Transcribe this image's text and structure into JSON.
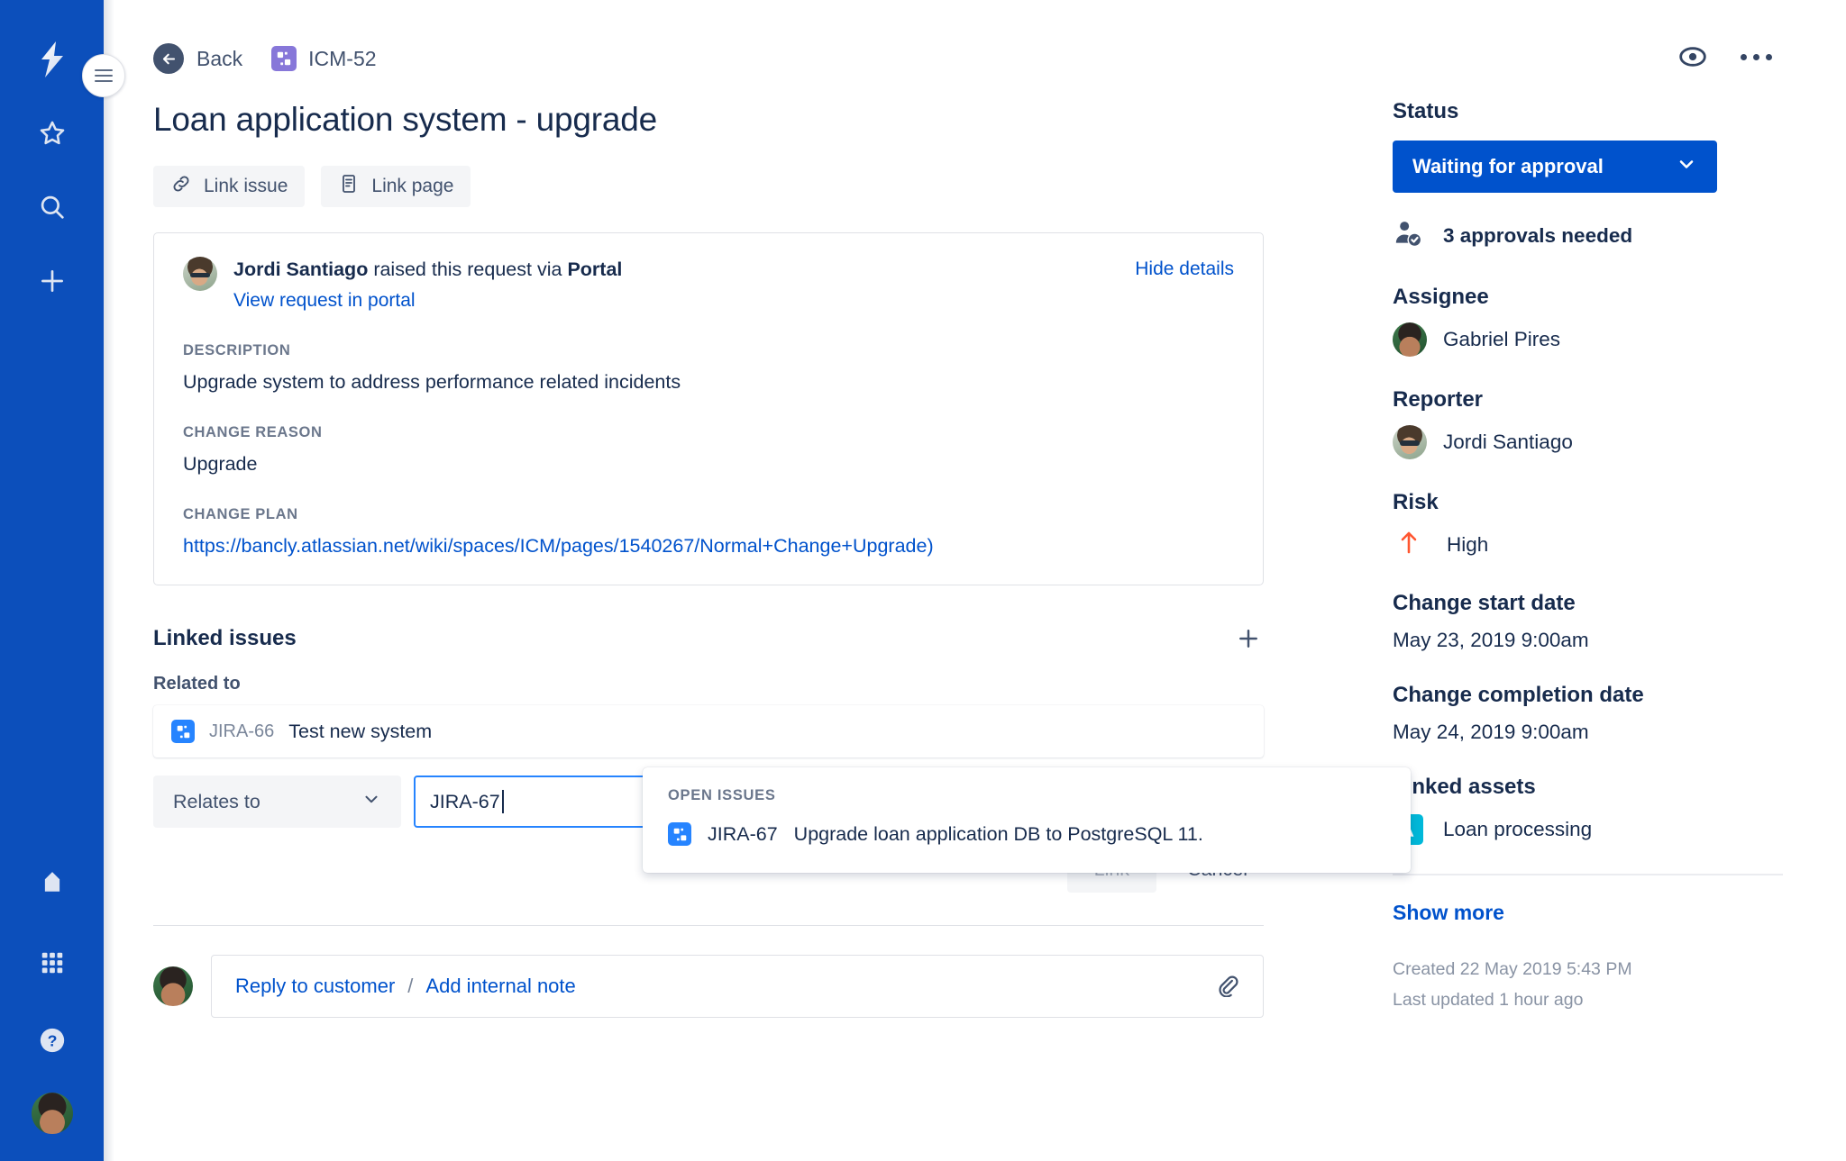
{
  "global_nav": {
    "logo_icon": "atlassian-jira-logo-icon",
    "items": [
      {
        "name": "starred",
        "icon": "star-icon"
      },
      {
        "name": "search",
        "icon": "search-icon"
      },
      {
        "name": "create",
        "icon": "plus-icon"
      }
    ],
    "bottom_items": [
      {
        "name": "labels",
        "icon": "tag-icon"
      },
      {
        "name": "apps",
        "icon": "grid-apps-icon"
      },
      {
        "name": "help",
        "icon": "question-circle-icon"
      },
      {
        "name": "profile",
        "icon": "avatar-icon"
      }
    ]
  },
  "header": {
    "back_label": "Back",
    "issue_key": "ICM-52",
    "issue_key_icon": "change-request-icon",
    "watch_icon": "eye-icon",
    "more_icon": "more-actions-icon"
  },
  "page_title": "Loan application system - upgrade",
  "actions": {
    "link_issue": "Link issue",
    "link_issue_icon": "chain-link-icon",
    "link_page": "Link page",
    "link_page_icon": "page-document-icon"
  },
  "request_card": {
    "reporter_name": "Jordi Santiago",
    "raised_text": "raised this request via",
    "channel": "Portal",
    "portal_link": "View request in portal",
    "hide_details": "Hide details",
    "fields": [
      {
        "label": "Description",
        "value": "Upgrade system to address performance related incidents",
        "type": "text"
      },
      {
        "label": "Change reason",
        "value": "Upgrade",
        "type": "text"
      },
      {
        "label": "Change plan",
        "value": "https://bancly.atlassian.net/wiki/spaces/ICM/pages/1540267/Normal+Change+Upgrade)",
        "type": "link"
      }
    ]
  },
  "linked_issues": {
    "section_title": "Linked issues",
    "add_icon": "plus-icon",
    "relationship_label": "Related to",
    "rows": [
      {
        "icon": "jira-task-icon",
        "key": "JIRA-66",
        "summary": "Test new system"
      }
    ],
    "form": {
      "link_type_value": "Relates to",
      "chevron_icon": "chevron-down-icon",
      "search_value": "JIRA-67",
      "submit_label": "Link",
      "cancel_label": "Cancel"
    },
    "typeahead": {
      "group_heading": "Open issues",
      "options": [
        {
          "icon": "jira-task-icon",
          "key": "JIRA-67",
          "summary": "Upgrade loan application DB to PostgreSQL 11."
        }
      ]
    }
  },
  "comment_bar": {
    "reply_label": "Reply to customer",
    "separator": "/",
    "internal_note_label": "Add internal note",
    "attach_icon": "paperclip-icon"
  },
  "details_panel": {
    "status_label": "Status",
    "status_value": "Waiting for approval",
    "status_chevron_icon": "chevron-down-icon",
    "approvals_icon": "person-approved-icon",
    "approvals_text": "3 approvals needed",
    "assignee_label": "Assignee",
    "assignee_name": "Gabriel Pires",
    "reporter_label": "Reporter",
    "reporter_name": "Jordi Santiago",
    "risk_label": "Risk",
    "risk_icon": "arrow-up-icon",
    "risk_value": "High",
    "change_start_label": "Change start date",
    "change_start_value": "May 23, 2019 9:00am",
    "change_completion_label": "Change completion date",
    "change_completion_value": "May 24, 2019 9:00am",
    "linked_assets_label": "Linked assets",
    "linked_asset_icon": "assets-app-icon",
    "linked_asset_value": "Loan processing",
    "show_more": "Show more",
    "created_text": "Created 22 May 2019 5:43 PM",
    "updated_text": "Last updated 1 hour ago"
  },
  "colors": {
    "nav_blue": "#0C4FBB",
    "primary_blue": "#0052CC",
    "link_blue": "#0052CC",
    "text_dark": "#172B4D",
    "text_subtle": "#6B778C",
    "focus_blue": "#2684FF",
    "risk_red": "#FF5630",
    "asset_teal": "#00B8D9",
    "key_purple": "#8777D9"
  }
}
